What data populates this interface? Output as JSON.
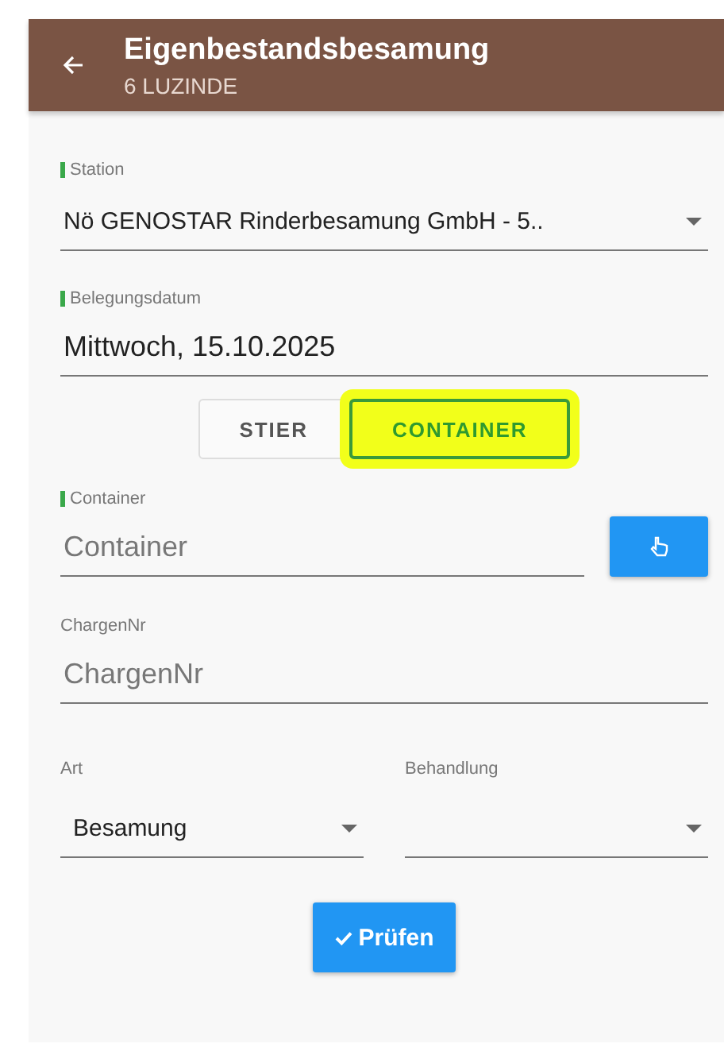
{
  "header": {
    "title": "Eigenbestandsbesamung",
    "subtitle": "6 LUZINDE"
  },
  "station": {
    "label": "Station",
    "required": true,
    "value": "Nö GENOSTAR Rinderbesamung GmbH - 5.."
  },
  "date": {
    "label": "Belegungsdatum",
    "required": true,
    "value": "Mittwoch, 15.10.2025"
  },
  "toggle": [
    {
      "label": "STIER",
      "selected": false,
      "highlighted": false
    },
    {
      "label": "CONTAINER",
      "selected": true,
      "highlighted": true
    }
  ],
  "container": {
    "label": "Container",
    "required": true,
    "placeholder": "Container"
  },
  "charge": {
    "label": "ChargenNr",
    "required": false,
    "placeholder": "ChargenNr"
  },
  "art": {
    "label": "Art",
    "value": "Besamung"
  },
  "behandlung": {
    "label": "Behandlung"
  },
  "submit": "Prüfen"
}
